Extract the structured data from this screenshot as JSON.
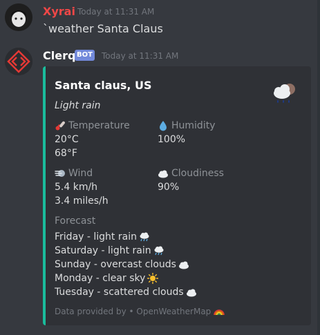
{
  "messages": [
    {
      "username": "Xyrai",
      "username_color": "#f04747",
      "timestamp": "Today at 11:31 AM",
      "content": "`weather Santa Claus"
    },
    {
      "username": "Clerq",
      "username_color": "#ffffff",
      "badge": "BOT",
      "timestamp": "Today at 11:31 AM"
    }
  ],
  "embed": {
    "accent_color": "#1abc9c",
    "title": "Santa claus, US",
    "description": "Light rain",
    "thumbnail_icon": "rain-cloud-icon",
    "fields": {
      "temperature": {
        "name": "Temperature",
        "icon": "thermometer-icon",
        "values": [
          "20°C",
          "68°F"
        ]
      },
      "humidity": {
        "name": "Humidity",
        "icon": "droplet-icon",
        "values": [
          "100%"
        ]
      },
      "wind": {
        "name": "Wind",
        "icon": "wind-icon",
        "values": [
          "5.4 km/h",
          "3.4 miles/h"
        ]
      },
      "cloudiness": {
        "name": "Cloudiness",
        "icon": "cloud-icon",
        "values": [
          "90%"
        ]
      }
    },
    "forecast_label": "Forecast",
    "forecast": [
      {
        "text": "Friday - light rain",
        "icon": "rain-cloud-icon"
      },
      {
        "text": "Saturday - light rain",
        "icon": "rain-cloud-icon"
      },
      {
        "text": "Sunday - overcast clouds",
        "icon": "cloud-icon"
      },
      {
        "text": "Monday - clear sky",
        "icon": "sun-icon"
      },
      {
        "text": "Tuesday - scattered clouds",
        "icon": "cloud-icon"
      }
    ],
    "footer": "Data provided by • OpenWeatherMap",
    "footer_icon": "rainbow-icon"
  }
}
